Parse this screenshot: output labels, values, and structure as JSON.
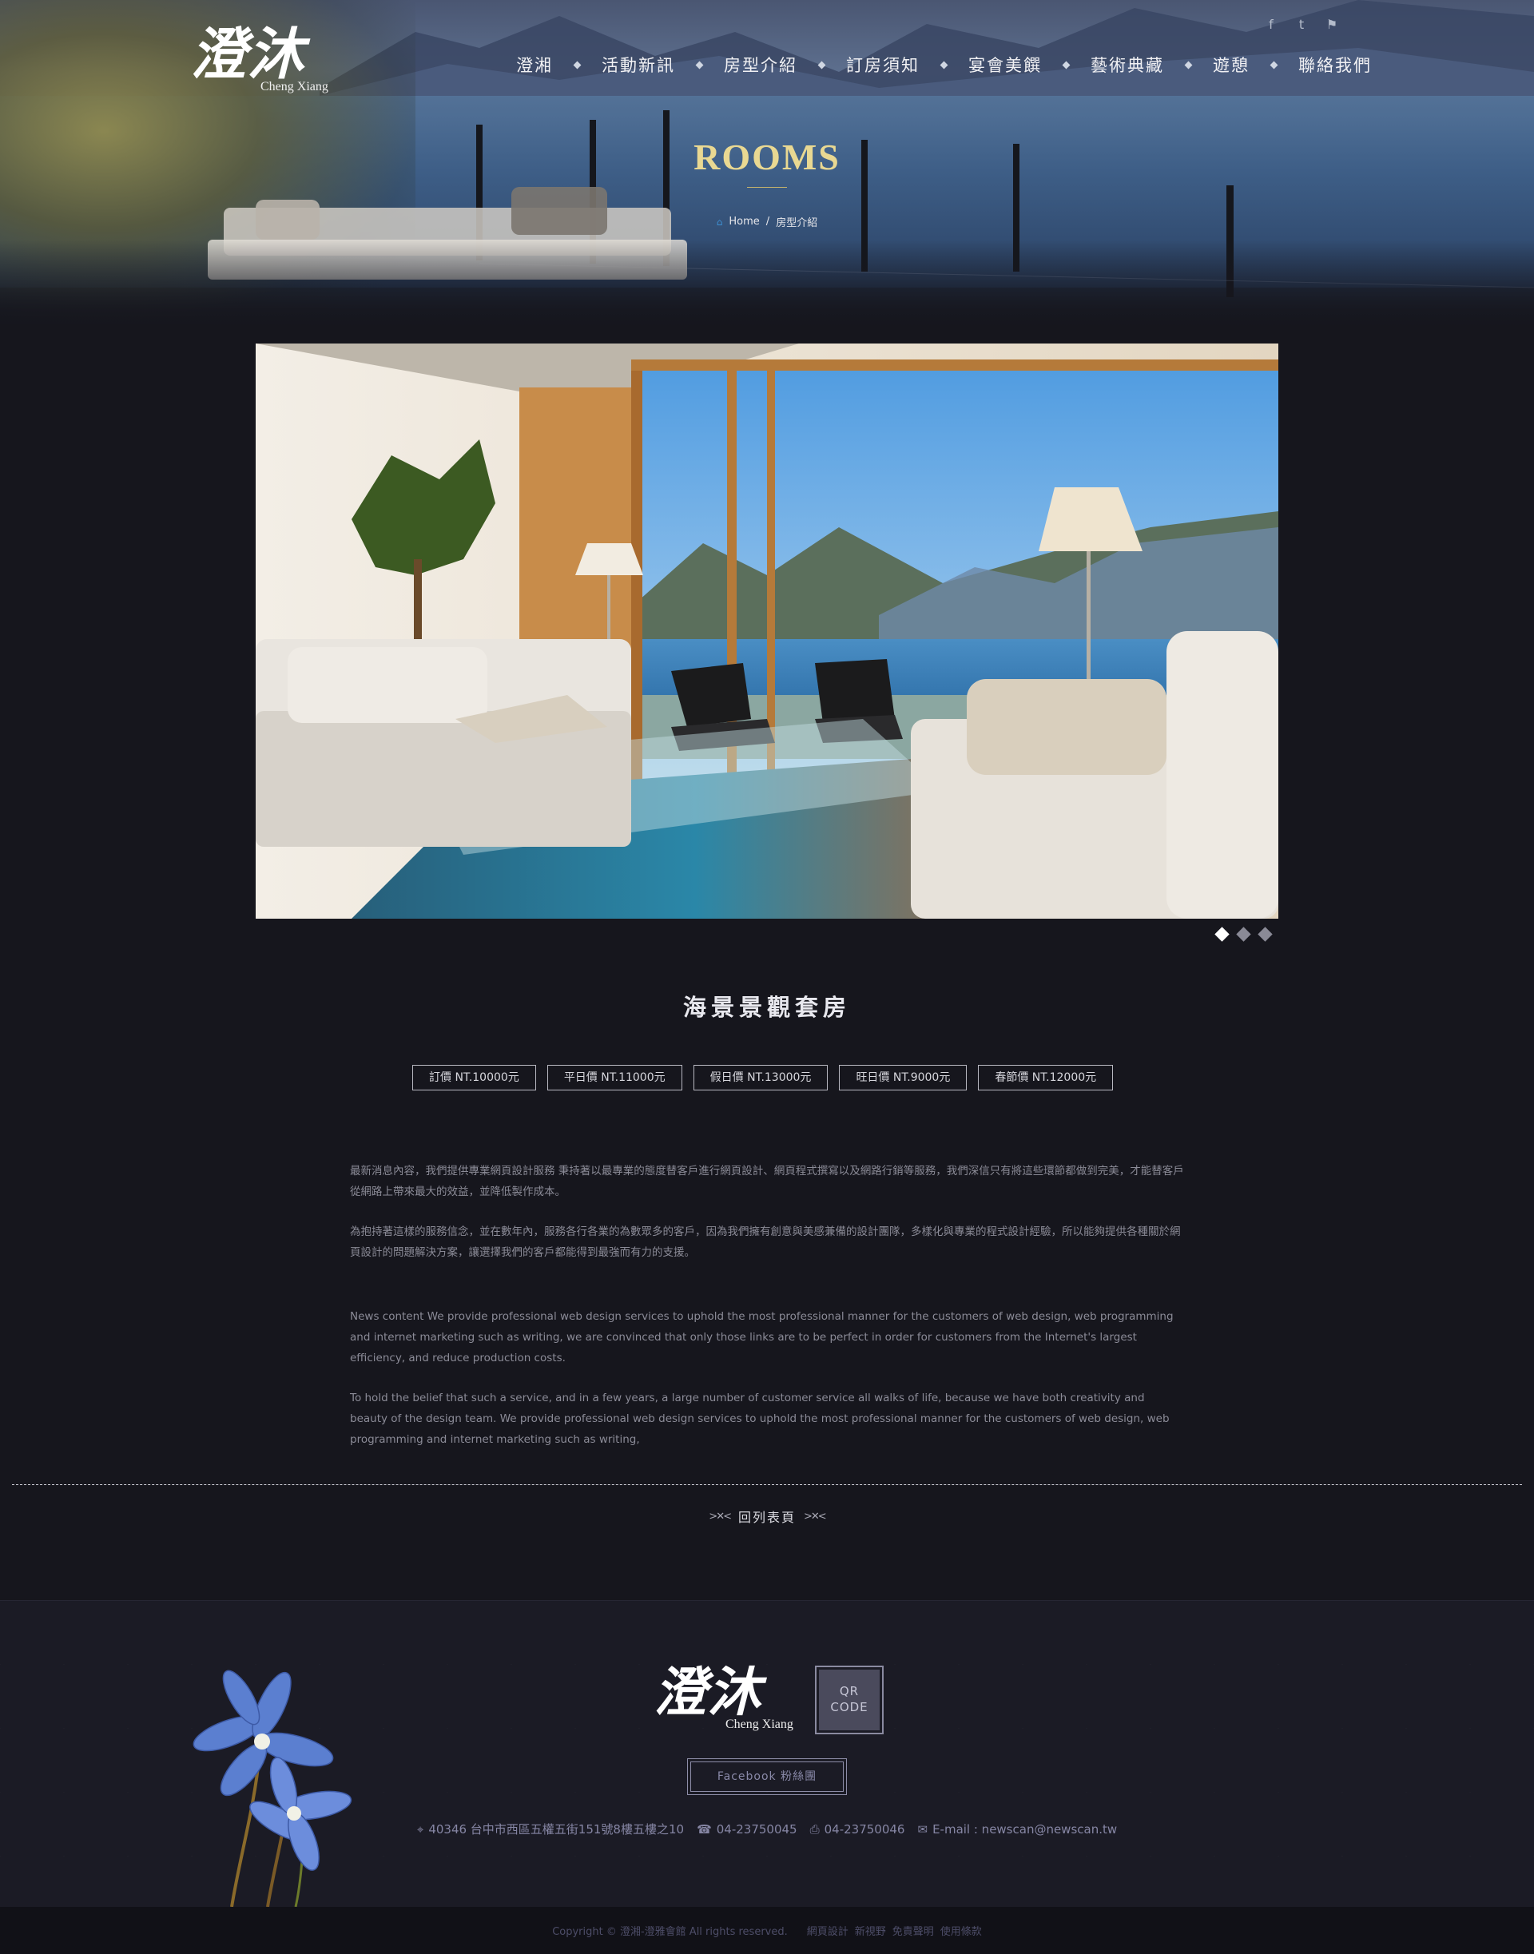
{
  "brand": {
    "logo_zh": "澄沐",
    "logo_en": "Cheng Xiang"
  },
  "social": [
    {
      "icon": "facebook-icon",
      "glyph": "f"
    },
    {
      "icon": "twitter-icon",
      "glyph": "t"
    },
    {
      "icon": "flag-icon",
      "glyph": "⚑"
    }
  ],
  "nav": {
    "items": [
      "澄湘",
      "活動新訊",
      "房型介紹",
      "訂房須知",
      "宴會美饌",
      "藝術典藏",
      "遊憩",
      "聯絡我們"
    ]
  },
  "hero": {
    "title": "ROOMS",
    "breadcrumb": {
      "home": "Home",
      "separator": "/",
      "current": "房型介紹"
    }
  },
  "slider": {
    "total": 3,
    "active": 1
  },
  "room": {
    "title": "海景景觀套房",
    "prices": [
      "訂價 NT.10000元",
      "平日價 NT.11000元",
      "假日價 NT.13000元",
      "旺日價 NT.9000元",
      "春節價 NT.12000元"
    ],
    "paragraphs_zh": [
      "最新消息內容，我們提供專業網頁設計服務 秉持著以最專業的態度替客戶進行網頁設計、網頁程式撰寫以及網路行銷等服務，我們深信只有將這些環節都做到完美，才能替客戶從網路上帶來最大的效益，並降低製作成本。",
      "為抱持著這樣的服務信念，並在數年內，服務各行各業的為數眾多的客戶，因為我們擁有創意與美感兼備的設計團隊，多樣化與專業的程式設計經驗，所以能夠提供各種關於網頁設計的問題解決方案，讓選擇我們的客戶都能得到最強而有力的支援。"
    ],
    "paragraphs_en": [
      "News content We provide professional web design services to uphold the most professional manner for the customers of web design, web programming and internet marketing such as writing, we are convinced that only those links are to be perfect in order for customers from the Internet's largest efficiency, and reduce production costs.",
      "To hold the belief that such a service, and in a few years, a large number of customer service all walks of life, because we have both creativity and beauty of the design team. We provide professional web design services to uphold the most professional manner for the customers of web design, web programming and internet marketing such as writing,"
    ],
    "back_label": "回列表頁"
  },
  "footer": {
    "qr_label": "QR CODE",
    "facebook_label": "Facebook 粉絲團",
    "address": "40346 台中市西區五權五街151號8樓五樓之10",
    "phone": "04-23750045",
    "fax": "04-23750046",
    "email": "E-mail : newscan@newscan.tw",
    "copyright": "Copyright © 澄湘-澄雅會館 All rights reserved.",
    "links": [
      "網頁設計",
      "新視野",
      "免責聲明",
      "使用條款"
    ]
  },
  "colors": {
    "accent_gold": "#e9d892",
    "bg": "#16161d",
    "footer_text": "#8686a4"
  }
}
